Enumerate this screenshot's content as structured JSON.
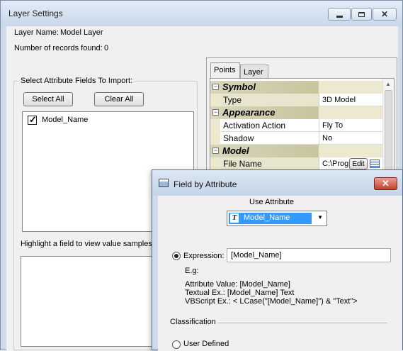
{
  "window": {
    "title": "Layer Settings",
    "layer_name_label": "Layer Name:",
    "layer_name_value": "Model Layer",
    "records_label": "Number of records found:",
    "records_value": "0"
  },
  "attributes": {
    "group_label": "Select Attribute Fields To Import:",
    "select_all_label": "Select All",
    "clear_all_label": "Clear All",
    "fields": [
      {
        "name": "Model_Name",
        "checked": true
      }
    ],
    "hint": "Highlight a field to view value samples."
  },
  "property_grid": {
    "tabs": [
      "Points",
      "Layer"
    ],
    "rows": [
      {
        "kind": "category",
        "name": "Symbol"
      },
      {
        "kind": "property",
        "name": "Type",
        "value": "3D Model"
      },
      {
        "kind": "category",
        "name": "Appearance"
      },
      {
        "kind": "property",
        "name": "Activation Action",
        "value": "Fly To"
      },
      {
        "kind": "property",
        "name": "Shadow",
        "value": "No"
      },
      {
        "kind": "category",
        "name": "Model"
      },
      {
        "kind": "property",
        "name": "File Name",
        "value": "C:\\Progr",
        "edit_label": "Edit"
      }
    ]
  },
  "dialog": {
    "title": "Field by Attribute",
    "close_icon": "close-icon",
    "use_attribute_label": "Use Attribute",
    "attribute_selected": "Model_Name",
    "expression_label": "Expression:",
    "expression_value": "[Model_Name]",
    "example_header": "E.g:",
    "examples": [
      "Attribute Value: [Model_Name]",
      "Textual Ex.: [Model_Name] Text",
      "VBScript Ex.: < LCase(\"[Model_Name]\") & \"Text\">"
    ],
    "classification_label": "Classification",
    "user_defined_label": "User Defined"
  }
}
